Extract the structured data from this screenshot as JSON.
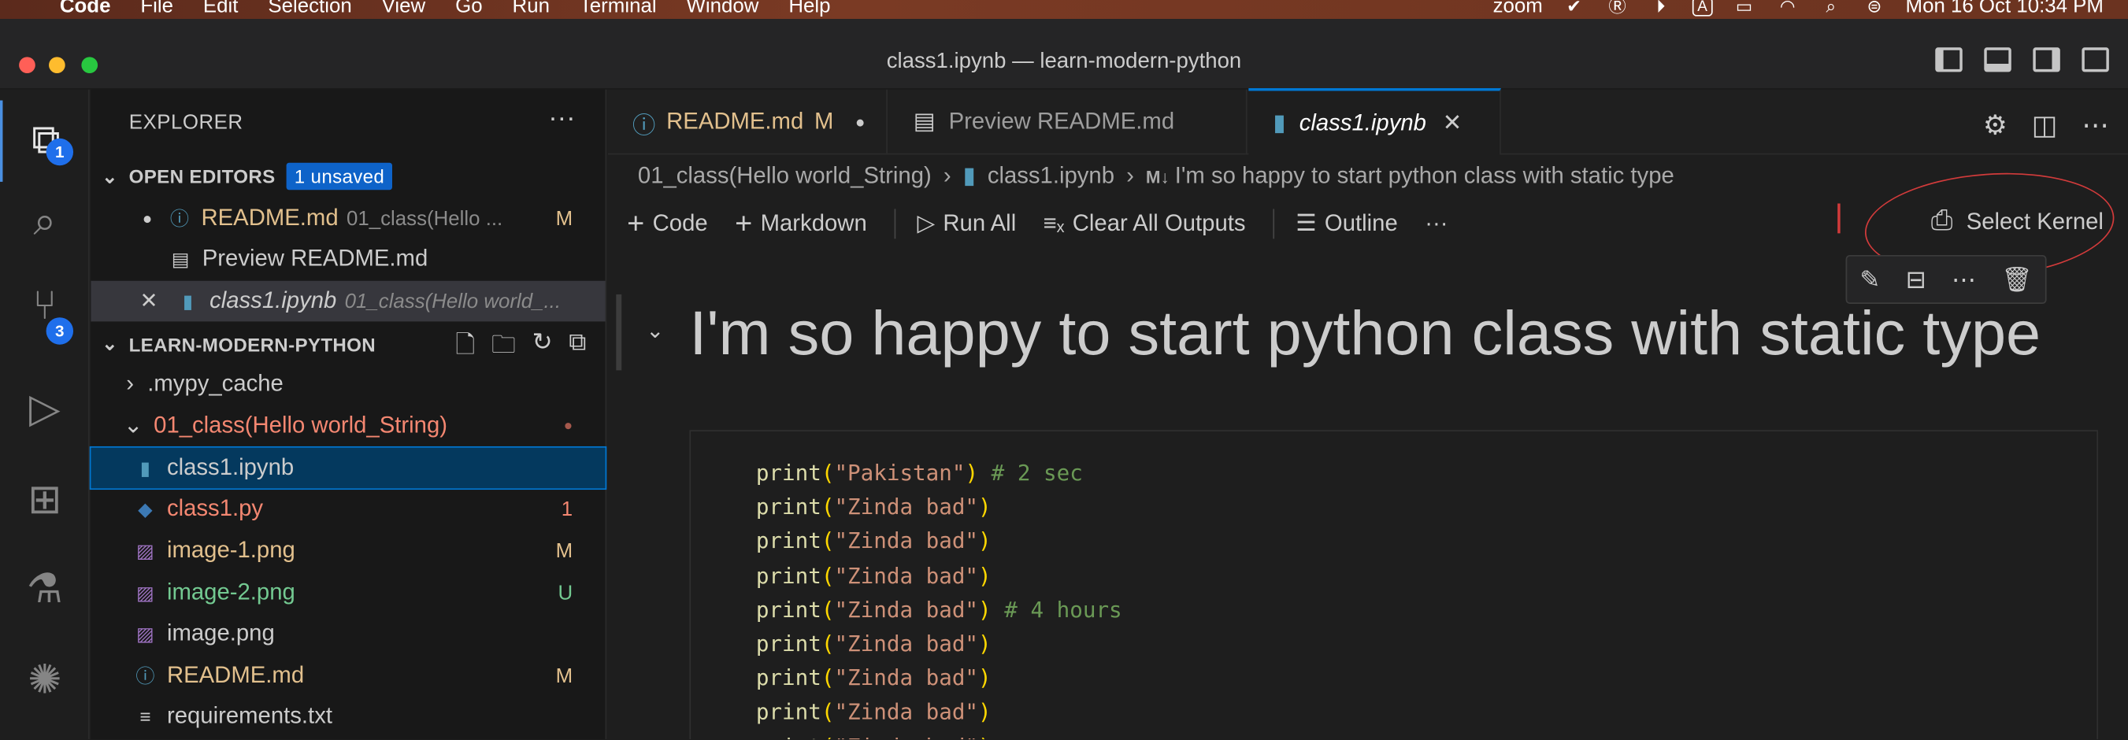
{
  "menubar": {
    "apple": "",
    "app": "Code",
    "items": [
      "File",
      "Edit",
      "Selection",
      "View",
      "Go",
      "Run",
      "Terminal",
      "Window",
      "Help"
    ],
    "zoom": "zoom",
    "datetime": "Mon 16 Oct  10:34 PM"
  },
  "window": {
    "title": "class1.ipynb — learn-modern-python"
  },
  "activity": {
    "explorer_badge": "1",
    "scm_badge": "3"
  },
  "sidebar": {
    "title": "EXPLORER",
    "more": "···",
    "open_editors": {
      "label": "OPEN EDITORS",
      "unsaved": "1 unsaved",
      "items": [
        {
          "name": "README.md",
          "desc": "01_class(Hello ...",
          "status": "M"
        },
        {
          "name": "Preview README.md",
          "desc": "",
          "status": ""
        },
        {
          "name": "class1.ipynb",
          "desc": "01_class(Hello world_...",
          "status": ""
        }
      ]
    },
    "project": {
      "label": "LEARN-MODERN-PYTHON",
      "items": [
        {
          "name": ".mypy_cache",
          "status": ""
        },
        {
          "name": "01_class(Hello world_String)",
          "status": "●"
        },
        {
          "name": "class1.ipynb",
          "status": ""
        },
        {
          "name": "class1.py",
          "status": "1"
        },
        {
          "name": "image-1.png",
          "status": "M"
        },
        {
          "name": "image-2.png",
          "status": "U"
        },
        {
          "name": "image.png",
          "status": ""
        },
        {
          "name": "README.md",
          "status": "M"
        },
        {
          "name": "requirements.txt",
          "status": ""
        }
      ]
    }
  },
  "tabs": [
    {
      "label": "README.md",
      "status": "M"
    },
    {
      "label": "Preview README.md"
    },
    {
      "label": "class1.ipynb"
    }
  ],
  "breadcrumbs": {
    "folder": "01_class(Hello world_String)",
    "file": "class1.ipynb",
    "md_marker": "M↓",
    "heading": "I'm so happy to start python class with static type"
  },
  "toolbar": {
    "code": "Code",
    "markdown": "Markdown",
    "run_all": "Run All",
    "clear": "Clear All Outputs",
    "outline": "Outline",
    "more": "···",
    "kernel": "Select Kernel"
  },
  "notebook": {
    "heading": "I'm so happy to start python class with static type",
    "code_lines": [
      {
        "fn": "print",
        "arg": "\"Pakistan\"",
        "comment": "# 2 sec"
      },
      {
        "fn": "print",
        "arg": "\"Zinda bad\"",
        "comment": ""
      },
      {
        "fn": "print",
        "arg": "\"Zinda bad\"",
        "comment": ""
      },
      {
        "fn": "print",
        "arg": "\"Zinda bad\"",
        "comment": ""
      },
      {
        "fn": "print",
        "arg": "\"Zinda bad\"",
        "comment": "# 4 hours"
      },
      {
        "fn": "print",
        "arg": "\"Zinda bad\"",
        "comment": ""
      },
      {
        "fn": "print",
        "arg": "\"Zinda bad\"",
        "comment": ""
      },
      {
        "fn": "print",
        "arg": "\"Zinda bad\"",
        "comment": ""
      },
      {
        "fn": "print",
        "arg": "\"Zinda bad\"",
        "comment": ""
      }
    ]
  },
  "colors": {
    "accent": "#0078d4",
    "modified": "#e2c08d",
    "untracked": "#73c991",
    "error": "#f48771",
    "annotation": "#d23b3b"
  }
}
